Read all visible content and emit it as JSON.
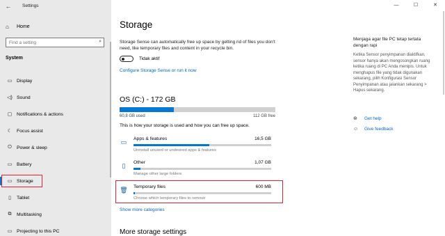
{
  "window": {
    "title": "Settings",
    "controls": {
      "minimize": "—",
      "maximize": "☐",
      "close": "✕"
    }
  },
  "sidebar": {
    "home_label": "Home",
    "search_placeholder": "Find a setting",
    "section_title": "System",
    "items": [
      {
        "label": "Display",
        "icon": "display-icon",
        "glyph": "▭"
      },
      {
        "label": "Sound",
        "icon": "speaker-icon",
        "glyph": "◁)"
      },
      {
        "label": "Notifications & actions",
        "icon": "notification-icon",
        "glyph": "▢"
      },
      {
        "label": "Focus assist",
        "icon": "moon-icon",
        "glyph": "☾"
      },
      {
        "label": "Power & sleep",
        "icon": "power-icon",
        "glyph": "⏻"
      },
      {
        "label": "Battery",
        "icon": "battery-icon",
        "glyph": "▭"
      },
      {
        "label": "Storage",
        "icon": "storage-icon",
        "glyph": "▭",
        "selected": true
      },
      {
        "label": "Tablet",
        "icon": "tablet-icon",
        "glyph": "▯"
      },
      {
        "label": "Multitasking",
        "icon": "multitasking-icon",
        "glyph": "⧉"
      },
      {
        "label": "Projecting to this PC",
        "icon": "projecting-icon",
        "glyph": "▭"
      }
    ]
  },
  "main": {
    "title": "Storage",
    "storage_sense_desc": "Storage Sense can automatically free up space by getting rid of files you don't need, like temporary files and content in your recycle bin.",
    "toggle_state_label": "Tidak aktif",
    "configure_link": "Configure Storage Sense or run it now",
    "drive": {
      "title": "OS (C:) - 172 GB",
      "used_label": "60,8 GB used",
      "free_label": "112 GB free",
      "used_fraction": 0.35
    },
    "usage_desc": "This is how your storage is used and how you can free up space.",
    "categories": [
      {
        "name": "Apps & features",
        "size": "16,5 GB",
        "sub": "Uninstall unused or undesired apps & features",
        "fraction": 0.55,
        "icon": "apps-icon"
      },
      {
        "name": "Other",
        "size": "1,07 GB",
        "sub": "Manage other large folders",
        "fraction": 0.05,
        "icon": "folder-icon"
      },
      {
        "name": "Temporary files",
        "size": "600 MB",
        "sub": "Choose which temporary files to remove",
        "fraction": 0.01,
        "icon": "trash-icon"
      }
    ],
    "show_more": "Show more categories",
    "more_settings": "More storage settings"
  },
  "right": {
    "title": "Menjaga agar file PC tetap tertata dengan rapi",
    "text": "Ketika Sensor penyimpanan diaktifkan, sensor hanya akan mengosongkan ruang ketika ruang di PC Anda menipis. Untuk menghapus file yang tidak digunakan sekarang, pilih Konfigurasi Sensor Penyimpanan atau jalankan sekarang > Hapus sekarang.",
    "get_help": "Get help",
    "give_feedback": "Give feedback"
  },
  "colors": {
    "accent": "#0078d7",
    "highlight": "#e0232c",
    "link": "#0066cc"
  }
}
